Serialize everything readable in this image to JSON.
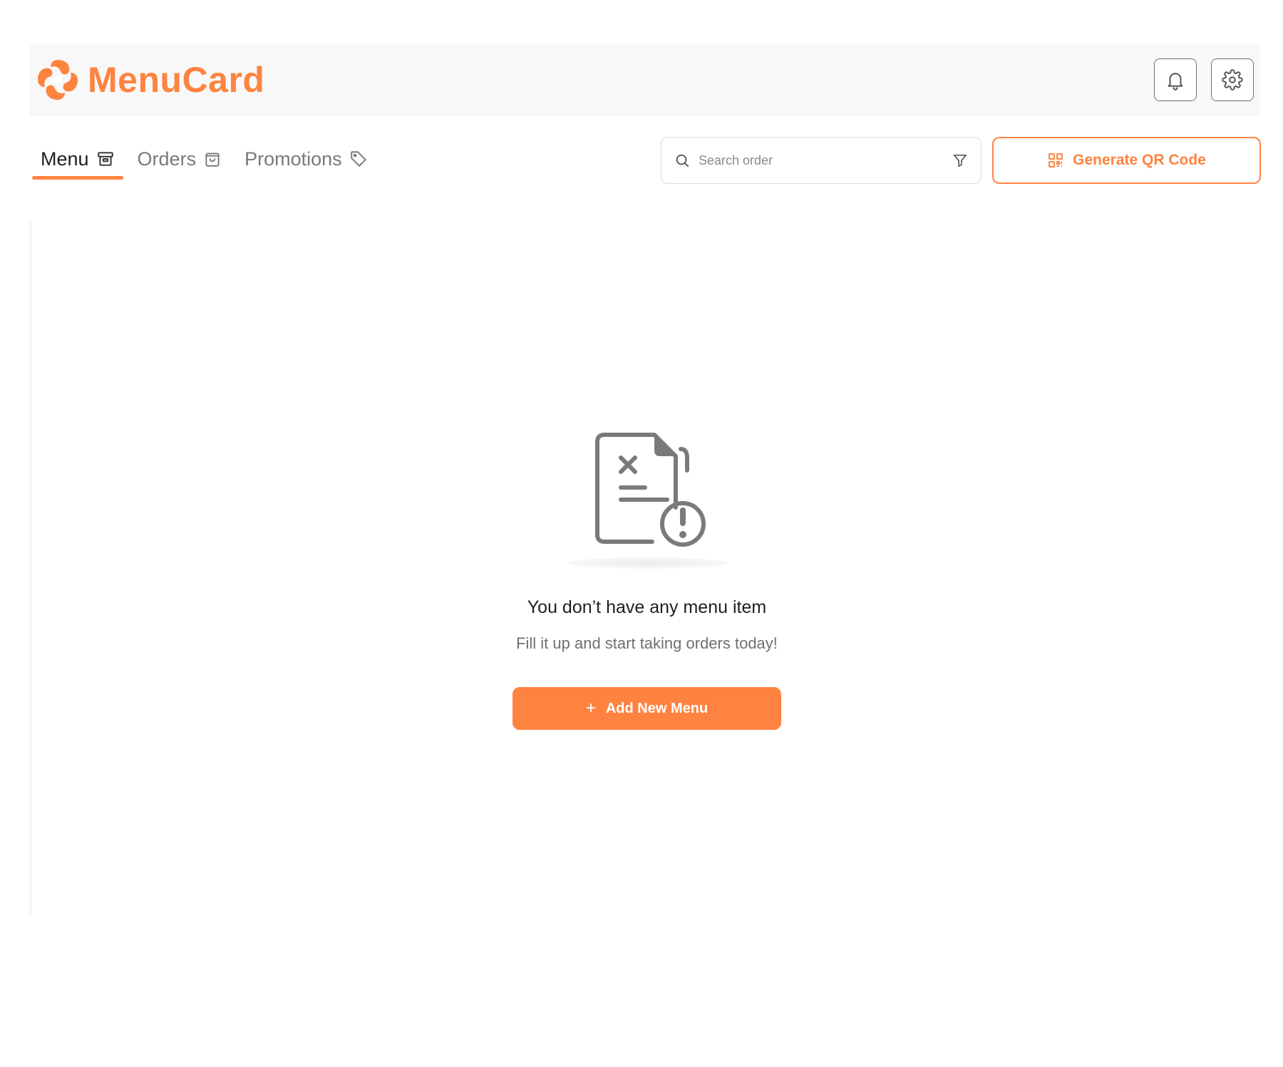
{
  "header": {
    "brand_name": "MenuCard",
    "brand_color": "#ff8340",
    "logo_icon": "menucard-logo",
    "notifications_icon": "bell-icon",
    "settings_icon": "gear-icon"
  },
  "tabs": [
    {
      "label": "Menu",
      "icon": "archive-box-icon",
      "active": true
    },
    {
      "label": "Orders",
      "icon": "shopping-bag-icon",
      "active": false
    },
    {
      "label": "Promotions",
      "icon": "tag-icon",
      "active": false
    }
  ],
  "search": {
    "placeholder": "Search order",
    "value": "",
    "icon": "search-icon",
    "filter_icon": "filter-icon"
  },
  "qr_button": {
    "label": "Generate QR Code",
    "icon": "qr-code-icon"
  },
  "empty_state": {
    "illustration": "empty-document-alert-icon",
    "title": "You don’t have any menu item",
    "subtitle": "Fill it up and start taking orders today!",
    "button_label": "Add New Menu",
    "button_icon": "plus-icon"
  },
  "colors": {
    "accent": "#ff8340",
    "header_bg": "#f8f8f8",
    "muted_text": "#7a7a7a"
  }
}
